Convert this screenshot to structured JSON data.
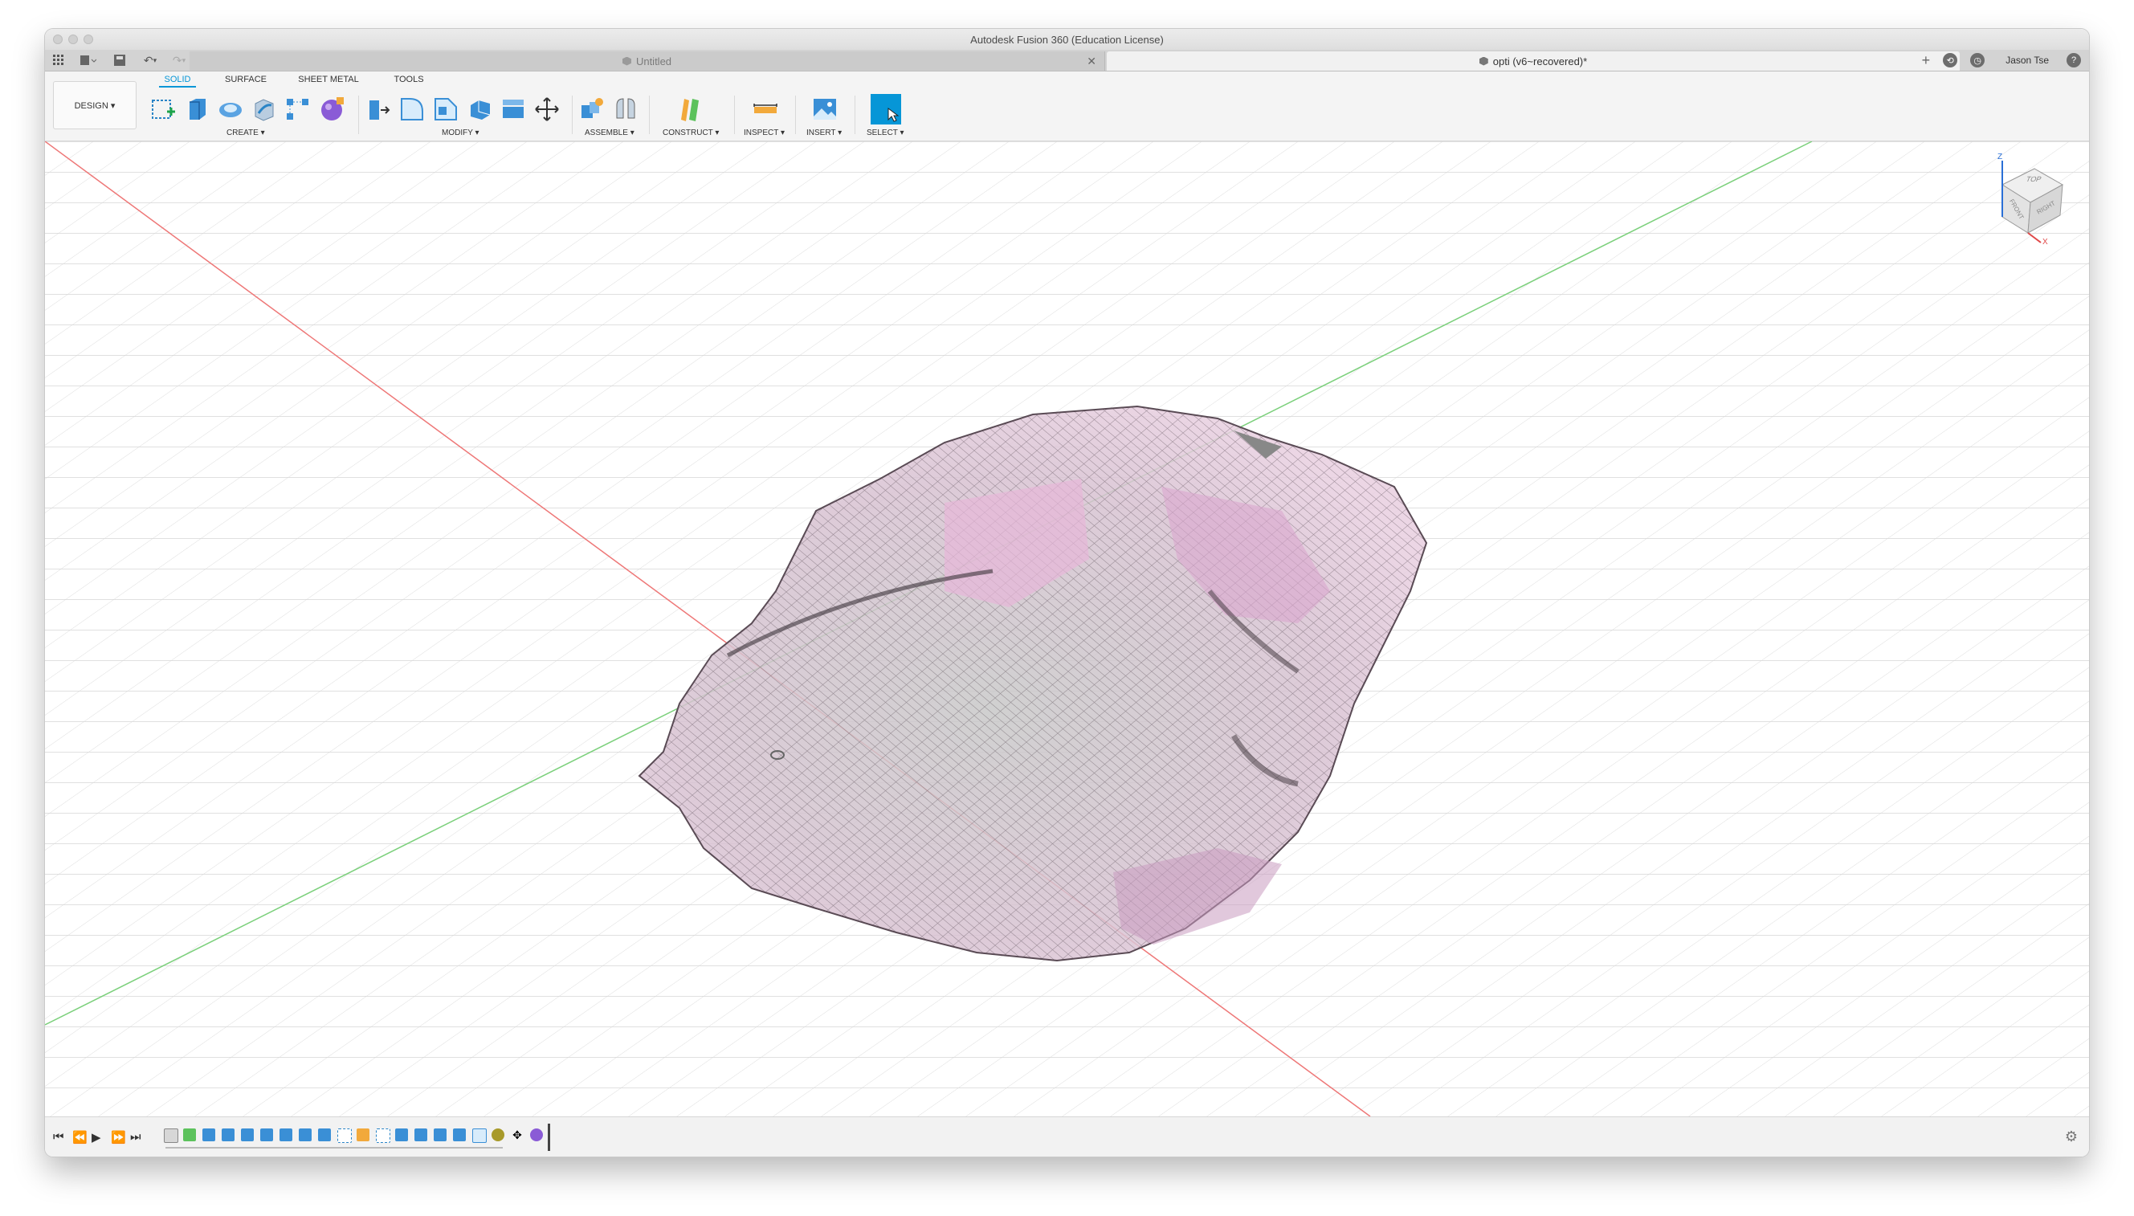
{
  "window": {
    "title": "Autodesk Fusion 360 (Education License)"
  },
  "tabs": {
    "inactive_label": "Untitled",
    "active_label": "opti (v6~recovered)*",
    "user_name": "Jason Tse"
  },
  "toolbar": {
    "workspace": "DESIGN ▾",
    "ws_tabs": [
      "SOLID",
      "SURFACE",
      "SHEET METAL",
      "TOOLS"
    ],
    "groups": [
      "CREATE ▾",
      "MODIFY ▾",
      "ASSEMBLE ▾",
      "CONSTRUCT ▾",
      "INSPECT ▾",
      "INSERT ▾",
      "SELECT ▾"
    ]
  },
  "viewcube": {
    "top": "TOP",
    "front": "FRONT",
    "right": "RIGHT",
    "axis_x": "X",
    "axis_z": "Z"
  },
  "colors": {
    "accent": "#0696d7",
    "mesh_fill": "#d9b7cf",
    "mesh_edge": "#5a4b55",
    "axis_red": "#e04848",
    "axis_green": "#5cc25c",
    "grid": "#d9d9d9"
  },
  "icons": [
    "grid-menu-icon",
    "file-icon",
    "save-icon",
    "undo-icon",
    "redo-icon",
    "close-icon",
    "new-tab-icon",
    "help-icon",
    "gear-icon"
  ]
}
